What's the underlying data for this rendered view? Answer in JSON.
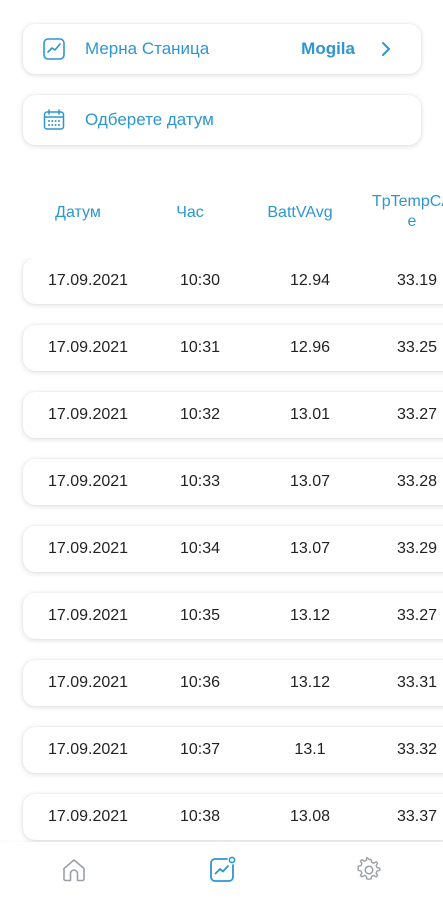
{
  "station": {
    "label": "Мерна Станица",
    "value": "Mogila"
  },
  "date": {
    "label": "Одберете датум"
  },
  "table": {
    "headers": [
      "Датум",
      "Час",
      "BattVAvg",
      "TpTempCA\ne"
    ],
    "rows": [
      [
        "17.09.2021",
        "10:30",
        "12.94",
        "33.19"
      ],
      [
        "17.09.2021",
        "10:31",
        "12.96",
        "33.25"
      ],
      [
        "17.09.2021",
        "10:32",
        "13.01",
        "33.27"
      ],
      [
        "17.09.2021",
        "10:33",
        "13.07",
        "33.28"
      ],
      [
        "17.09.2021",
        "10:34",
        "13.07",
        "33.29"
      ],
      [
        "17.09.2021",
        "10:35",
        "13.12",
        "33.27"
      ],
      [
        "17.09.2021",
        "10:36",
        "13.12",
        "33.31"
      ],
      [
        "17.09.2021",
        "10:37",
        "13.1",
        "33.32"
      ],
      [
        "17.09.2021",
        "10:38",
        "13.08",
        "33.37"
      ]
    ]
  },
  "nav": {
    "items": [
      {
        "icon": "home-icon",
        "active": false
      },
      {
        "icon": "chart-icon",
        "active": true
      },
      {
        "icon": "settings-icon",
        "active": false
      }
    ]
  },
  "colors": {
    "accent": "#2e96d1",
    "inactive": "#9aa0a6",
    "text": "#222222"
  }
}
